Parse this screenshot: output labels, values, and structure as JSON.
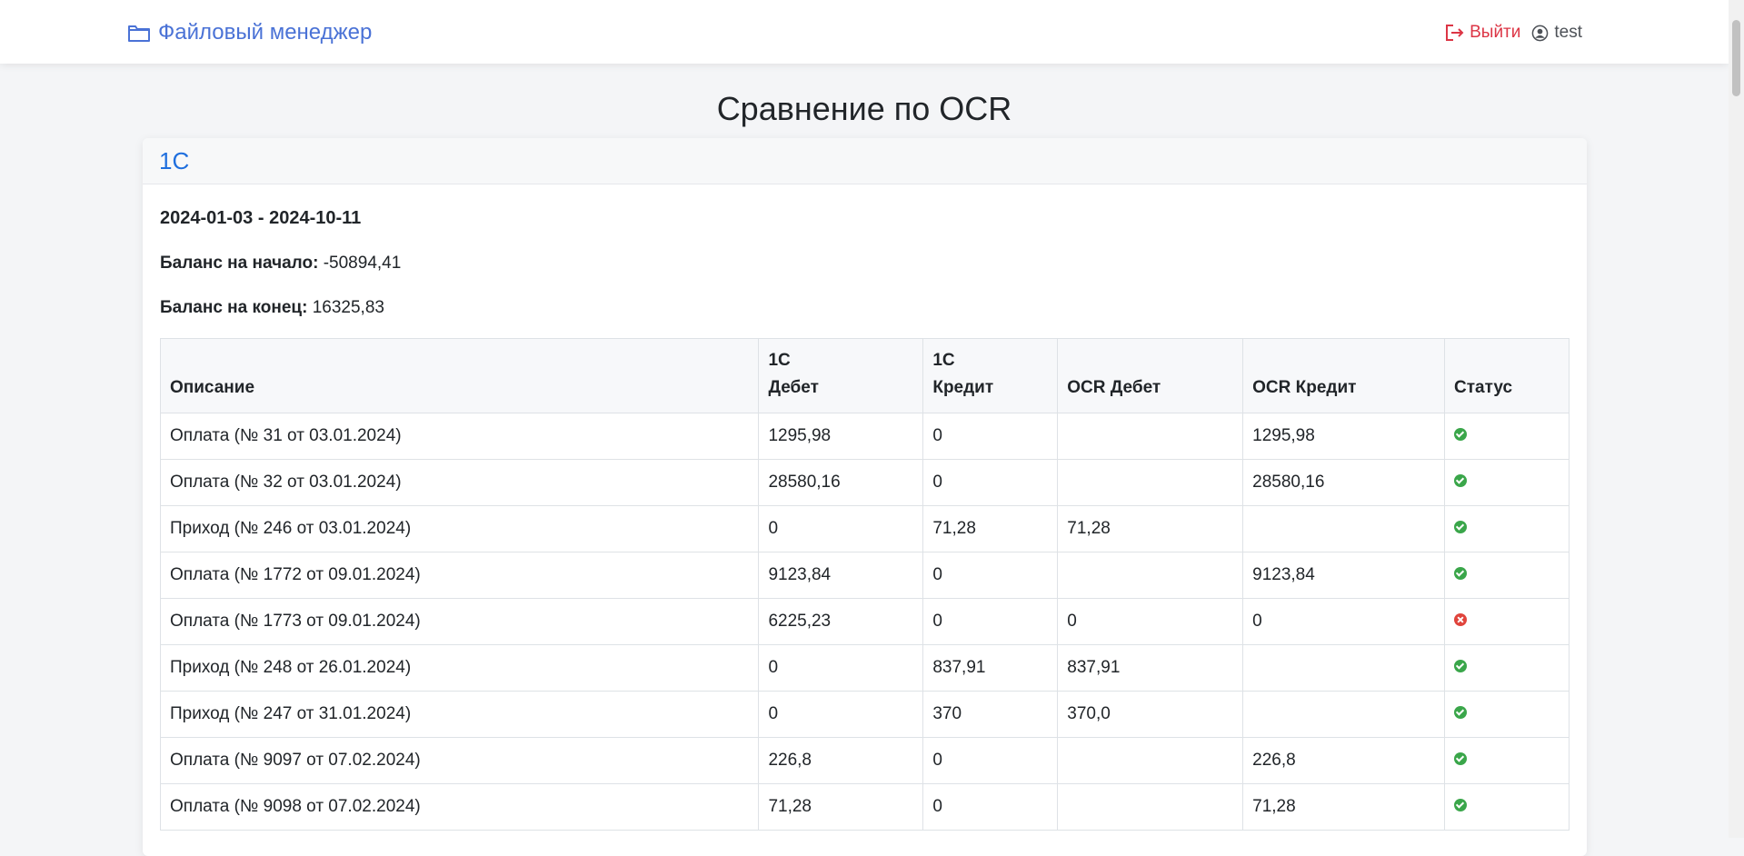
{
  "navbar": {
    "brand_label": "Файловый менеджер",
    "logout_label": "Выйти",
    "username": "test"
  },
  "page": {
    "title": "Сравнение по OCR"
  },
  "card": {
    "header": "1С",
    "period": "2024-01-03 - 2024-10-11",
    "balance_start_label": "Баланс на начало:",
    "balance_start_value": "-50894,41",
    "balance_end_label": "Баланс на конец:",
    "balance_end_value": "16325,83"
  },
  "table": {
    "headers": {
      "description": "Описание",
      "debit_1c_line1": "1С",
      "debit_1c_line2": "Дебет",
      "credit_1c_line1": "1С",
      "credit_1c_line2": "Кредит",
      "ocr_debit": "OCR Дебет",
      "ocr_credit": "OCR Кредит",
      "status": "Статус"
    },
    "rows": [
      {
        "desc": "Оплата (№ 31 от 03.01.2024)",
        "debit_1c": "1295,98",
        "credit_1c": "0",
        "ocr_debit": "",
        "ocr_credit": "1295,98",
        "status": "ok"
      },
      {
        "desc": "Оплата (№ 32 от 03.01.2024)",
        "debit_1c": "28580,16",
        "credit_1c": "0",
        "ocr_debit": "",
        "ocr_credit": "28580,16",
        "status": "ok"
      },
      {
        "desc": "Приход (№ 246 от 03.01.2024)",
        "debit_1c": "0",
        "credit_1c": "71,28",
        "ocr_debit": "71,28",
        "ocr_credit": "",
        "status": "ok"
      },
      {
        "desc": "Оплата (№ 1772 от 09.01.2024)",
        "debit_1c": "9123,84",
        "credit_1c": "0",
        "ocr_debit": "",
        "ocr_credit": "9123,84",
        "status": "ok"
      },
      {
        "desc": "Оплата (№ 1773 от 09.01.2024)",
        "debit_1c": "6225,23",
        "credit_1c": "0",
        "ocr_debit": "0",
        "ocr_credit": "0",
        "status": "error"
      },
      {
        "desc": "Приход (№ 248 от 26.01.2024)",
        "debit_1c": "0",
        "credit_1c": "837,91",
        "ocr_debit": "837,91",
        "ocr_credit": "",
        "status": "ok"
      },
      {
        "desc": "Приход (№ 247 от 31.01.2024)",
        "debit_1c": "0",
        "credit_1c": "370",
        "ocr_debit": "370,0",
        "ocr_credit": "",
        "status": "ok"
      },
      {
        "desc": "Оплата (№ 9097 от 07.02.2024)",
        "debit_1c": "226,8",
        "credit_1c": "0",
        "ocr_debit": "",
        "ocr_credit": "226,8",
        "status": "ok"
      },
      {
        "desc": "Оплата (№ 9098 от 07.02.2024)",
        "debit_1c": "71,28",
        "credit_1c": "0",
        "ocr_debit": "",
        "ocr_credit": "71,28",
        "status": "ok"
      }
    ]
  },
  "colors": {
    "brand": "#4a72d6",
    "logout": "#dc3545",
    "header_link": "#1f6fde",
    "status_ok": "#3aa64a",
    "status_error": "#e0443c"
  },
  "icons": {
    "brand": "folder-icon",
    "logout": "logout-icon",
    "user": "user-circle-icon",
    "ok": "check-circle-icon",
    "error": "x-circle-icon"
  }
}
